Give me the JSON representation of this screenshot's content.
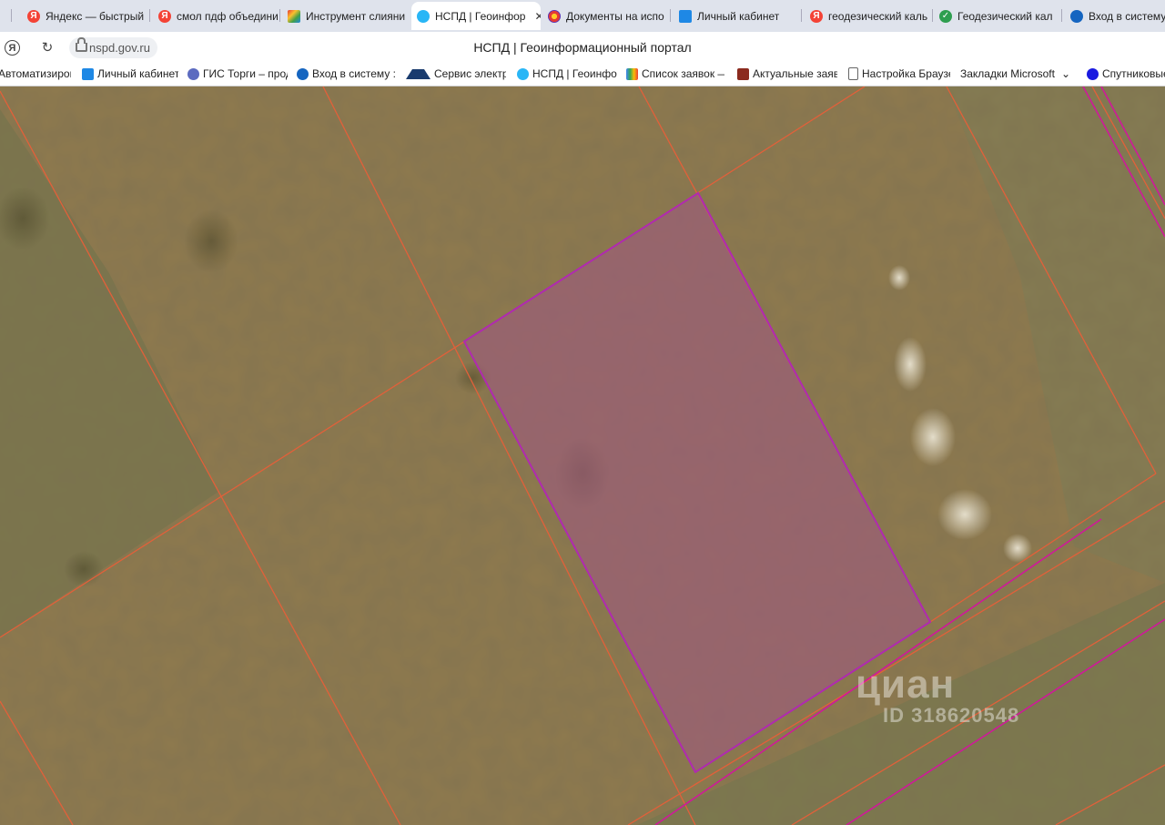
{
  "browser": {
    "tabs": [
      {
        "label": "Яндекс — быстрый",
        "icon": "yandex-icon",
        "color": "#f44336"
      },
      {
        "label": "смол пдф объедини",
        "icon": "yandex-icon",
        "color": "#f44336"
      },
      {
        "label": "Инструмент слияни",
        "icon": "merge-tool-icon",
        "color": "#8e44ad"
      },
      {
        "label": "НСПД | Геоинфор",
        "icon": "nspd-icon",
        "color": "#29b6f6",
        "active": true
      },
      {
        "label": "Документы на испо",
        "icon": "docs-icon",
        "color": "#e53935"
      },
      {
        "label": "Личный кабинет",
        "icon": "cabinet-icon",
        "color": "#1e88e5"
      },
      {
        "label": "геодезический каль",
        "icon": "yandex-icon",
        "color": "#f44336"
      },
      {
        "label": "Геодезический кал",
        "icon": "check-icon",
        "color": "#2e9e4f"
      },
      {
        "label": "Вход в систему",
        "icon": "gos-icon",
        "color": "#1565c0"
      }
    ],
    "address": {
      "url": "nspd.gov.ru",
      "page_title": "НСПД | Геоинформационный портал"
    },
    "bookmarks": [
      {
        "label": "Автоматизирован",
        "icon": "bookmark-icon"
      },
      {
        "label": "Личный кабинет",
        "icon": "cabinet-icon"
      },
      {
        "label": "ГИС Торги – прод",
        "icon": "gis-torgi-icon"
      },
      {
        "label": "Вход в систему :: Р",
        "icon": "gos-icon"
      },
      {
        "label": "Сервис электрон",
        "icon": "service-icon"
      },
      {
        "label": "НСПД | Геоинфор",
        "icon": "nspd-icon"
      },
      {
        "label": "Список заявок —",
        "icon": "gmail-icon"
      },
      {
        "label": "Актуальные заявл",
        "icon": "cube-icon"
      },
      {
        "label": "Настройка Браузе",
        "icon": "page-icon"
      },
      {
        "label": "Закладки Microsoft",
        "icon": "folder-icon"
      },
      {
        "label": "Спутниковые",
        "icon": "circle-icon"
      }
    ]
  },
  "map": {
    "parcel_line_color": "#e2603a",
    "selected_parcel_fill": "#9e5a7e",
    "selected_parcel_outline": "#b02ab0",
    "boundary_color": "#d0189b"
  },
  "watermark": {
    "brand": "циан",
    "id_text": "ID 318620548"
  }
}
